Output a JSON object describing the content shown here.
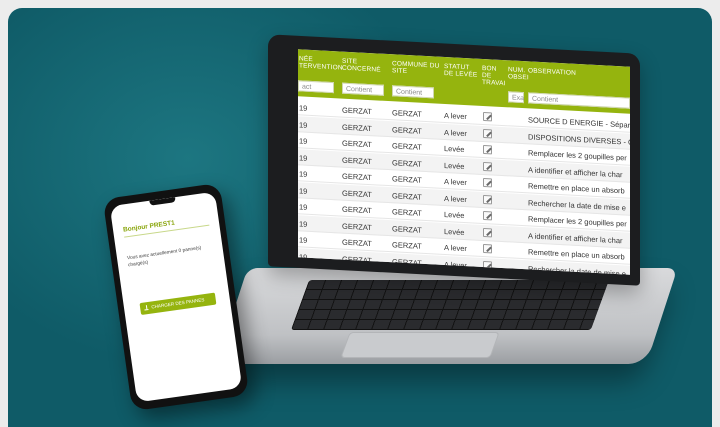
{
  "colors": {
    "background": "#0f5b67",
    "accent": "#95b40e"
  },
  "table": {
    "columns": [
      {
        "label": "NÉE\nTERVENTION",
        "filter": "act"
      },
      {
        "label": "SITE\nCONCERNÉ",
        "filter": "Contient"
      },
      {
        "label": "COMMUNE DU\nSITE",
        "filter": "Contient"
      },
      {
        "label": "STATUT\nDE LEVÉE",
        "filter": ""
      },
      {
        "label": "BON\nDE\nTRAVAI",
        "filter": ""
      },
      {
        "label": "NUM.\nOBSEI",
        "filter": "Exa"
      },
      {
        "label": "OBSERVATION",
        "filter": "Contient"
      }
    ],
    "rows": [
      {
        "year": "19",
        "site": "GERZAT",
        "commune": "GERZAT",
        "status": "A lever",
        "observation": "SOURCE D ENERGIE - Séparati"
      },
      {
        "year": "19",
        "site": "GERZAT",
        "commune": "GERZAT",
        "status": "A lever",
        "observation": "DISPOSITIONS DIVERSES - Co"
      },
      {
        "year": "19",
        "site": "GERZAT",
        "commune": "GERZAT",
        "status": "Levée",
        "observation": "Remplacer les 2 goupilles per"
      },
      {
        "year": "19",
        "site": "GERZAT",
        "commune": "GERZAT",
        "status": "Levée",
        "observation": "A identifier et afficher la char"
      },
      {
        "year": "19",
        "site": "GERZAT",
        "commune": "GERZAT",
        "status": "A lever",
        "observation": "Remettre en place un absorb"
      },
      {
        "year": "19",
        "site": "GERZAT",
        "commune": "GERZAT",
        "status": "A lever",
        "observation": "Rechercher la date de mise e"
      },
      {
        "year": "19",
        "site": "GERZAT",
        "commune": "GERZAT",
        "status": "Levée",
        "observation": "Remplacer les 2 goupilles per"
      },
      {
        "year": "19",
        "site": "GERZAT",
        "commune": "GERZAT",
        "status": "Levée",
        "observation": "A identifier et afficher la char"
      },
      {
        "year": "19",
        "site": "GERZAT",
        "commune": "GERZAT",
        "status": "A lever",
        "observation": "Remettre en place un absorb"
      },
      {
        "year": "19",
        "site": "GERZAT",
        "commune": "GERZAT",
        "status": "A lever",
        "observation": "Rechercher la date de mise e"
      }
    ]
  },
  "phone": {
    "greeting": "Bonjour PREST1",
    "message": "Vous avez actuellement 0 panne(s) chargé(s)",
    "button_label": "CHARGER DES PANNES"
  }
}
